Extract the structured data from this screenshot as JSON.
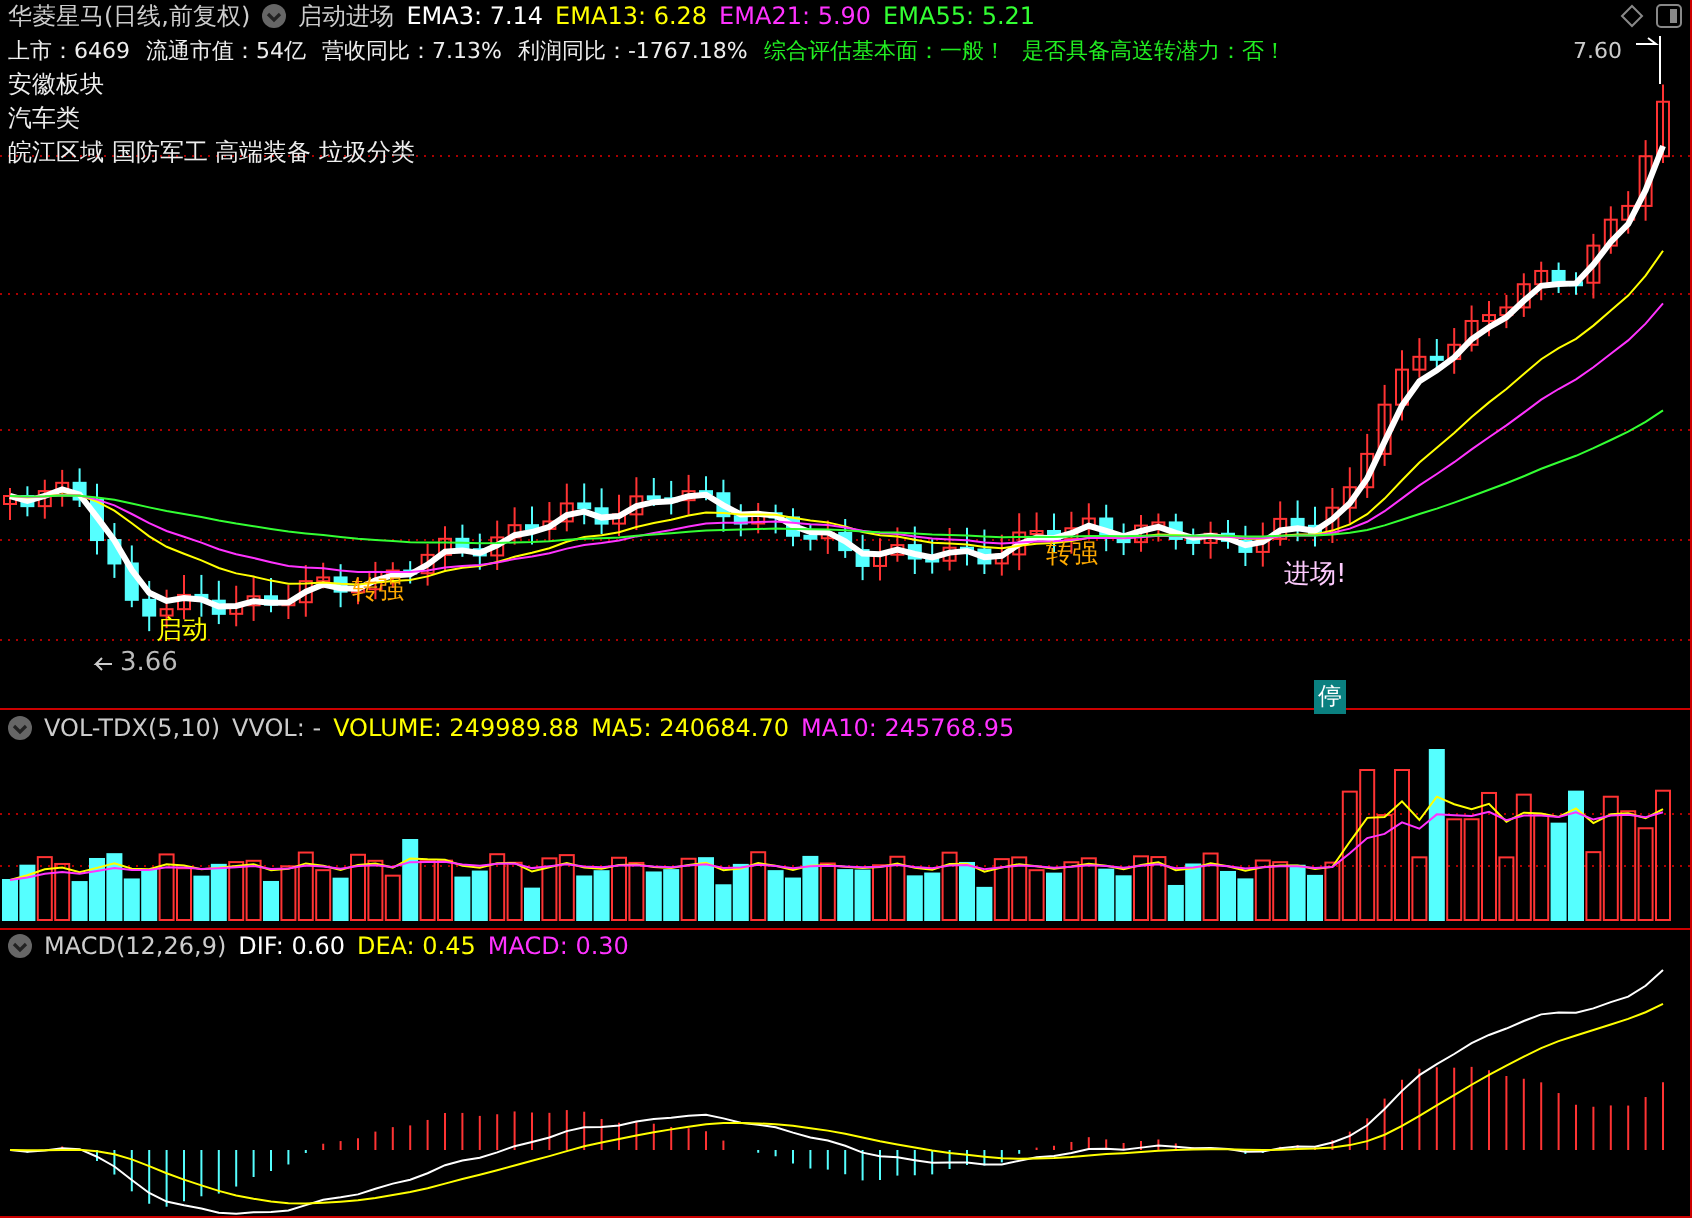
{
  "header": {
    "stock_name": "华菱星马(日线,前复权)",
    "indicator_name": "启动进场",
    "indicators": [
      {
        "label": "EMA3: 7.14",
        "color": "#ffffff"
      },
      {
        "label": "EMA13: 6.28",
        "color": "#ffff00"
      },
      {
        "label": "EMA21: 5.90",
        "color": "#ff33ff"
      },
      {
        "label": "EMA55: 5.21",
        "color": "#33ff33"
      }
    ]
  },
  "info_line": [
    "上市：6469",
    "流通市值：54亿",
    "营收同比：7.13%",
    "利润同比：-1767.18%"
  ],
  "assessment": [
    "综合评估基本面：一般！",
    "是否具备高送转潜力：否！"
  ],
  "sectors": [
    "安徽板块",
    "汽车类",
    "皖江区域 国防军工 高端装备 垃圾分类"
  ],
  "price_high": "7.60",
  "price_low": "3.66",
  "signals": [
    {
      "label": "启动",
      "color": "#ffff00"
    },
    {
      "label": "转强",
      "color": "#ffaa00"
    },
    {
      "label": "转强",
      "color": "#ffaa00"
    },
    {
      "label": "进场!",
      "color": "#ffccff"
    }
  ],
  "stop_badge": "停",
  "volume_panel": {
    "name": "VOL-TDX(5,10)",
    "sub": "VVOL: -",
    "values": [
      {
        "label": "VOLUME: 249989.88",
        "color": "#ffff00"
      },
      {
        "label": "MA5: 240684.70",
        "color": "#ffff00"
      },
      {
        "label": "MA10: 245768.95",
        "color": "#ff33ff"
      }
    ]
  },
  "macd_panel": {
    "name": "MACD(12,26,9)",
    "values": [
      {
        "label": "DIF: 0.60",
        "color": "#ffffff"
      },
      {
        "label": "DEA: 0.45",
        "color": "#ffff00"
      },
      {
        "label": "MACD: 0.30",
        "color": "#ff33ff"
      }
    ]
  }
}
